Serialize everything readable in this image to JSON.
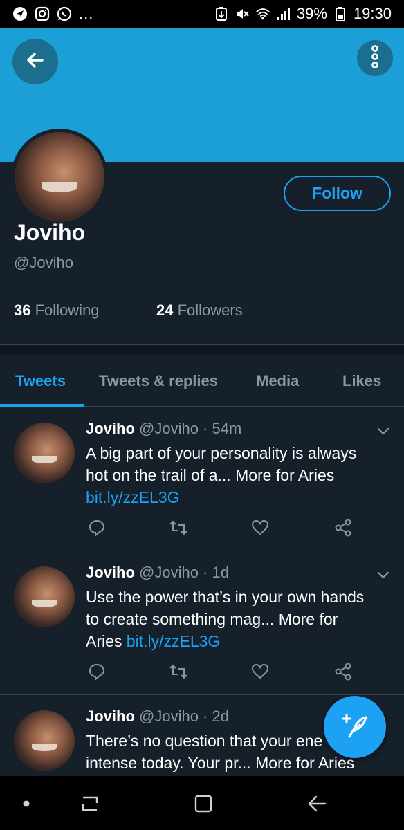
{
  "status_bar": {
    "left_icons": [
      "navigation-icon",
      "instagram-icon",
      "whatsapp-icon"
    ],
    "more": "...",
    "battery": "39%",
    "time": "19:30"
  },
  "profile": {
    "display_name": "Joviho",
    "handle": "@Joviho",
    "follow_label": "Follow",
    "following_count": "36",
    "following_label": "Following",
    "followers_count": "24",
    "followers_label": "Followers"
  },
  "tabs": [
    {
      "label": "Tweets",
      "active": true
    },
    {
      "label": "Tweets & replies",
      "active": false
    },
    {
      "label": "Media",
      "active": false
    },
    {
      "label": "Likes",
      "active": false
    }
  ],
  "tweets": [
    {
      "name": "Joviho",
      "handle": "@Joviho",
      "time": "· 54m",
      "text_line1": "A big part of your personality is always",
      "text_line2": "hot on the trail of a... More for Aries",
      "link": "bit.ly/zzEL3G"
    },
    {
      "name": "Joviho",
      "handle": "@Joviho",
      "time": "· 1d",
      "text_line1": "Use the power that’s in your own hands",
      "text_line2": "to create something mag... More for",
      "text_line3": "Aries",
      "link": "bit.ly/zzEL3G"
    },
    {
      "name": "Joviho",
      "handle": "@Joviho",
      "time": "· 2d",
      "text_line1": "There’s no question that your ene",
      "text_line2": "intense today. Your pr... More for Aries"
    }
  ],
  "colors": {
    "background": "#15202b",
    "banner": "#1b9fd6",
    "accent": "#1da1f2",
    "secondary_text": "#8899a6",
    "divider": "#38444d"
  }
}
